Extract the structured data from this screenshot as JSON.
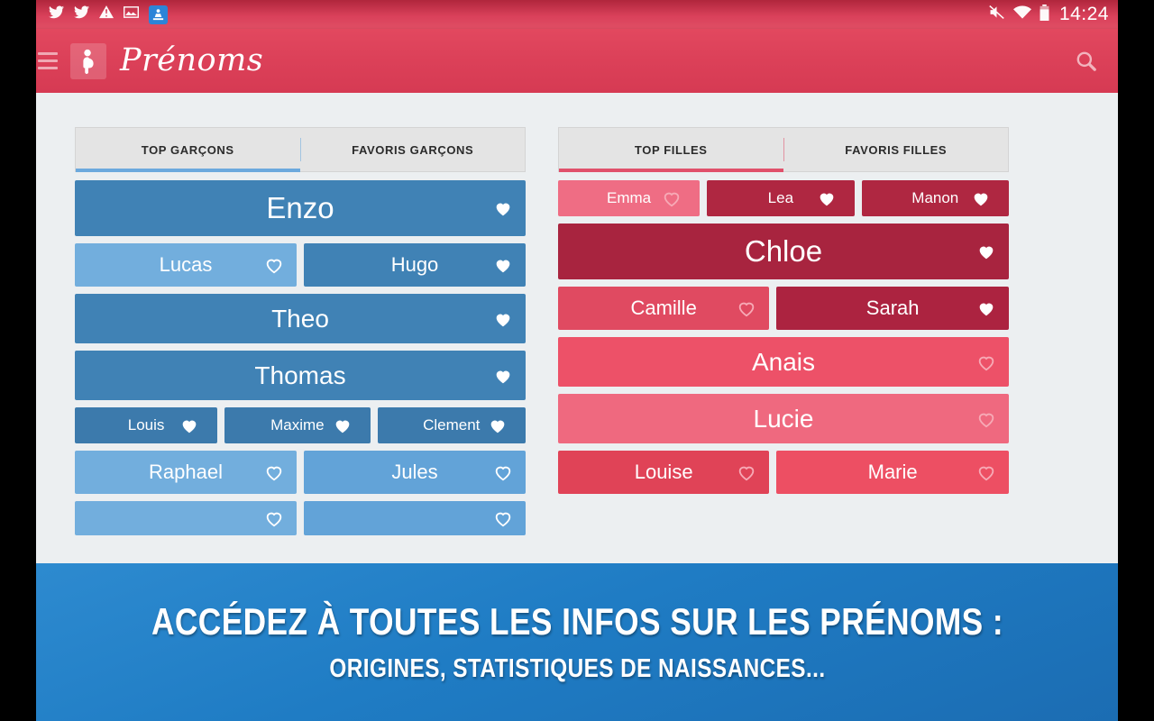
{
  "statusbar": {
    "clock": "14:24",
    "left_icons": [
      "twitter-icon",
      "twitter-icon",
      "warning-icon",
      "image-icon",
      "screenshot-thumbnail-icon"
    ],
    "right_icons": [
      "mute-icon",
      "wifi-icon",
      "battery-icon"
    ]
  },
  "appbar": {
    "menu_icon": "hamburger-menu-icon",
    "logo_icon": "pregnant-woman-logo-icon",
    "title": "Prénoms",
    "search_icon": "search-icon",
    "bg_color": "#dc4159"
  },
  "boys": {
    "accent": "#6ca9dd",
    "tabs": [
      {
        "label": "TOP GARÇONS",
        "selected": true
      },
      {
        "label": "FAVORIS GARÇONS",
        "selected": false
      }
    ],
    "rows": [
      [
        {
          "name": "Enzo",
          "favorite": true,
          "color": "#4082b5",
          "size": "xl",
          "flex": 1
        }
      ],
      [
        {
          "name": "Lucas",
          "favorite": false,
          "color": "#72aedd",
          "size": "md",
          "flex": 1
        },
        {
          "name": "Hugo",
          "favorite": true,
          "color": "#4082b5",
          "size": "md",
          "flex": 1
        }
      ],
      [
        {
          "name": "Theo",
          "favorite": true,
          "color": "#4082b5",
          "size": "lg",
          "flex": 1
        }
      ],
      [
        {
          "name": "Thomas",
          "favorite": true,
          "color": "#4082b5",
          "size": "lg",
          "flex": 1
        }
      ],
      [
        {
          "name": "Louis",
          "favorite": true,
          "color": "#3c7aac",
          "size": "sm",
          "flex": 1
        },
        {
          "name": "Maxime",
          "favorite": true,
          "color": "#3c7aac",
          "size": "sm",
          "flex": 1.02
        },
        {
          "name": "Clement",
          "favorite": true,
          "color": "#3c7aac",
          "size": "sm",
          "flex": 1.04
        }
      ],
      [
        {
          "name": "Raphael",
          "favorite": false,
          "color": "#72aedd",
          "size": "md",
          "flex": 1
        },
        {
          "name": "Jules",
          "favorite": false,
          "color": "#62a3d8",
          "size": "md",
          "flex": 1
        }
      ],
      [
        {
          "name": "",
          "favorite": false,
          "color": "#72aedd",
          "size": "xs",
          "flex": 1
        },
        {
          "name": "",
          "favorite": false,
          "color": "#62a3d8",
          "size": "xs",
          "flex": 1
        }
      ]
    ]
  },
  "girls": {
    "accent": "#e0506b",
    "tabs": [
      {
        "label": "TOP FILLES",
        "selected": true
      },
      {
        "label": "FAVORIS FILLES",
        "selected": false
      }
    ],
    "rows": [
      [
        {
          "name": "Emma",
          "favorite": false,
          "color": "#ef6d84",
          "size": "sm",
          "flex": 1
        },
        {
          "name": "Lea",
          "favorite": true,
          "color": "#af2741",
          "size": "sm",
          "flex": 1.04
        },
        {
          "name": "Manon",
          "favorite": true,
          "color": "#af2741",
          "size": "sm",
          "flex": 1.04
        }
      ],
      [
        {
          "name": "Chloe",
          "favorite": true,
          "color": "#a8243f",
          "size": "xl",
          "flex": 1
        }
      ],
      [
        {
          "name": "Camille",
          "favorite": false,
          "color": "#e04a61",
          "size": "md",
          "flex": 1
        },
        {
          "name": "Sarah",
          "favorite": true,
          "color": "#ac2340",
          "size": "md",
          "flex": 1.1
        }
      ],
      [
        {
          "name": "Anais",
          "favorite": false,
          "color": "#ed5168",
          "size": "lg",
          "flex": 1
        }
      ],
      [
        {
          "name": "Lucie",
          "favorite": false,
          "color": "#ef697f",
          "size": "lg",
          "flex": 1
        }
      ],
      [
        {
          "name": "Louise",
          "favorite": false,
          "color": "#e04357",
          "size": "md",
          "flex": 1
        },
        {
          "name": "Marie",
          "favorite": false,
          "color": "#ed4f63",
          "size": "md",
          "flex": 1.1
        }
      ]
    ]
  },
  "promo": {
    "line1": "ACCÉDEZ À TOUTES LES INFOS SUR LES PRÉNOMS :",
    "line2": "ORIGINES, STATISTIQUES DE NAISSANCES...",
    "bg_color": "#1f7cc4"
  }
}
